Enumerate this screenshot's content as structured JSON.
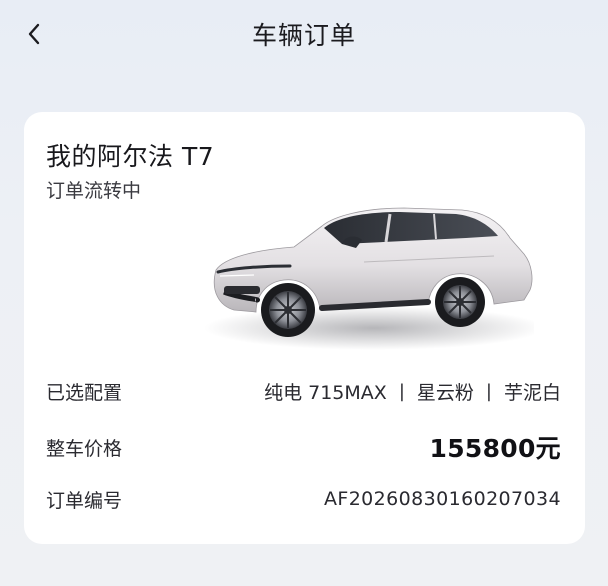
{
  "header": {
    "title": "车辆订单",
    "back_icon": "chevron-left-icon"
  },
  "vehicle": {
    "name": "我的阿尔法 T7",
    "status": "订单流转中",
    "image_desc": "car-image"
  },
  "details": {
    "config_label": "已选配置",
    "config_items": [
      "纯电 715MAX",
      "星云粉",
      "芋泥白"
    ],
    "config_separator": "|",
    "price_label": "整车价格",
    "price_value": "155800元",
    "order_label": "订单编号",
    "order_value": "AF20260830160207034"
  },
  "colors": {
    "background": "#eef1f6",
    "card": "#ffffff",
    "text_primary": "#18181c"
  }
}
